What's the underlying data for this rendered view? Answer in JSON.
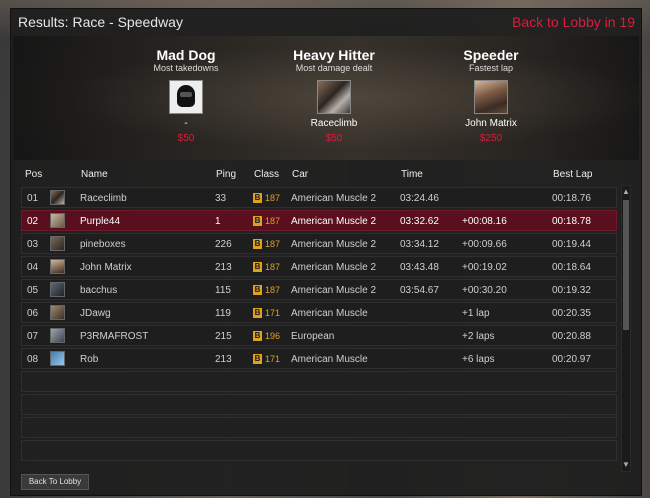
{
  "window": {
    "title": "Results: Race - Speedway",
    "lobby_timer": "Back to Lobby in 19"
  },
  "awards": [
    {
      "title": "Mad Dog",
      "subtitle": "Most takedowns",
      "player": "-",
      "prize": "$50",
      "avatar": "default-helmet"
    },
    {
      "title": "Heavy Hitter",
      "subtitle": "Most damage dealt",
      "player": "Raceclimb",
      "prize": "$50",
      "avatar": "car-photo"
    },
    {
      "title": "Speeder",
      "subtitle": "Fastest lap",
      "player": "John Matrix",
      "prize": "$250",
      "avatar": "portrait-photo"
    }
  ],
  "table": {
    "headers": {
      "pos": "Pos",
      "name": "Name",
      "ping": "Ping",
      "class": "Class",
      "car": "Car",
      "time": "Time",
      "best_lap": "Best Lap"
    },
    "rows": [
      {
        "pos": "01",
        "name": "Raceclimb",
        "ping": "33",
        "class_letter": "B",
        "class_value": "187",
        "car": "American Muscle 2",
        "time": "03:24.46",
        "gap": "",
        "best_lap": "00:18.76",
        "selected": false
      },
      {
        "pos": "02",
        "name": "Purple44",
        "ping": "1",
        "class_letter": "B",
        "class_value": "187",
        "car": "American Muscle 2",
        "time": "03:32.62",
        "gap": "+00:08.16",
        "best_lap": "00:18.78",
        "selected": true
      },
      {
        "pos": "03",
        "name": "pineboxes",
        "ping": "226",
        "class_letter": "B",
        "class_value": "187",
        "car": "American Muscle 2",
        "time": "03:34.12",
        "gap": "+00:09.66",
        "best_lap": "00:19.44",
        "selected": false
      },
      {
        "pos": "04",
        "name": "John Matrix",
        "ping": "213",
        "class_letter": "B",
        "class_value": "187",
        "car": "American Muscle 2",
        "time": "03:43.48",
        "gap": "+00:19.02",
        "best_lap": "00:18.64",
        "selected": false
      },
      {
        "pos": "05",
        "name": "bacchus",
        "ping": "115",
        "class_letter": "B",
        "class_value": "187",
        "car": "American Muscle 2",
        "time": "03:54.67",
        "gap": "+00:30.20",
        "best_lap": "00:19.32",
        "selected": false
      },
      {
        "pos": "06",
        "name": "JDawg",
        "ping": "119",
        "class_letter": "B",
        "class_value": "171",
        "car": "American Muscle",
        "time": "",
        "gap": "+1 lap",
        "best_lap": "00:20.35",
        "selected": false
      },
      {
        "pos": "07",
        "name": "P3RMAFROST",
        "ping": "215",
        "class_letter": "B",
        "class_value": "196",
        "car": "European",
        "time": "",
        "gap": "+2 laps",
        "best_lap": "00:20.88",
        "selected": false
      },
      {
        "pos": "08",
        "name": "Rob",
        "ping": "213",
        "class_letter": "B",
        "class_value": "171",
        "car": "American Muscle",
        "time": "",
        "gap": "+6 laps",
        "best_lap": "00:20.97",
        "selected": false
      }
    ],
    "empty_rows": 4
  },
  "buttons": {
    "back_to_lobby": "Back To Lobby"
  },
  "colors": {
    "accent_red": "#d81e3c",
    "selected_row": "#5a0f1e",
    "class_badge": "#e0a21c"
  },
  "icons": {
    "scroll_up": "chevron-up-icon",
    "scroll_down": "chevron-down-icon"
  }
}
